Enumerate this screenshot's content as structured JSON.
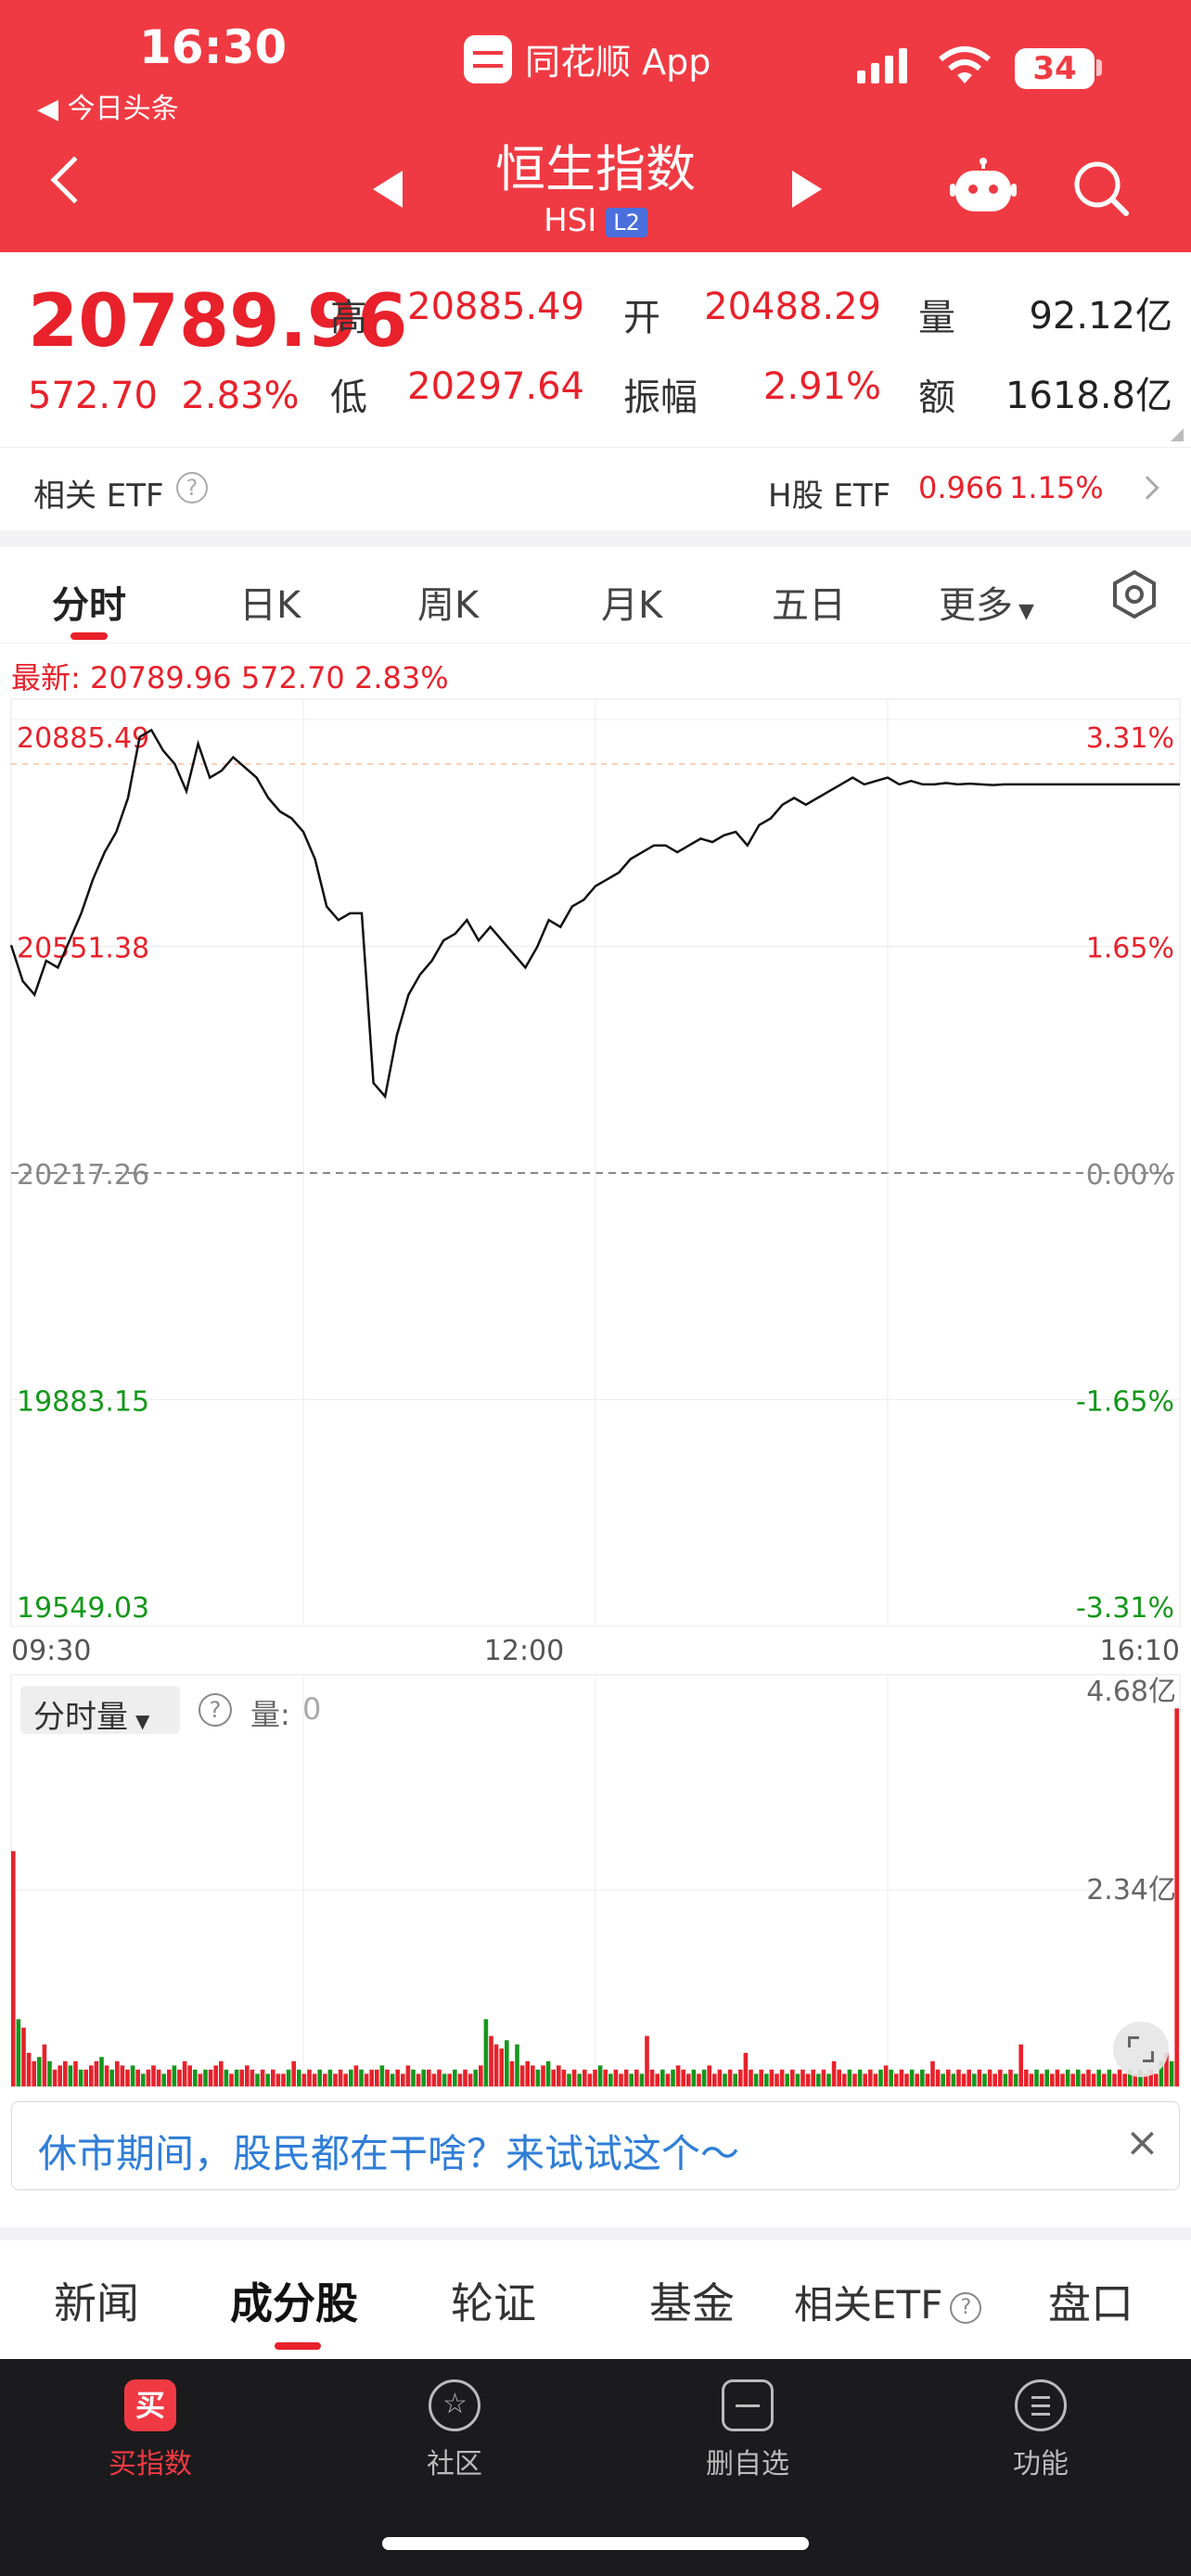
{
  "status_bar": {
    "time": "16:30",
    "back_app": "◀ 今日头条",
    "app_name": "同花顺 App",
    "battery": "34"
  },
  "header": {
    "title": "恒生指数",
    "code": "HSI",
    "level": "L2"
  },
  "quote": {
    "price": "20789.96",
    "change": "572.70",
    "change_pct": "2.83%",
    "high_label": "高",
    "high": "20885.49",
    "low_label": "低",
    "low": "20297.64",
    "open_label": "开",
    "open": "20488.29",
    "amp_label": "振幅",
    "amp": "2.91%",
    "vol_label": "量",
    "vol": "92.12亿",
    "amt_label": "额",
    "amt": "1618.8亿"
  },
  "etf": {
    "related_label": "相关 ETF",
    "h_label": "H股 ETF",
    "h_price": "0.966",
    "h_pct": "1.15%"
  },
  "tabs": [
    {
      "label": "分时"
    },
    {
      "label": "日K"
    },
    {
      "label": "周K"
    },
    {
      "label": "月K"
    },
    {
      "label": "五日"
    },
    {
      "label": "更多"
    }
  ],
  "latest_line": "最新: 20789.96  572.70  2.83%",
  "volume_panel": {
    "selector": "分时量",
    "qty_label": "量:",
    "qty_value": "0"
  },
  "colors": {
    "up": "#e8212b",
    "down": "#15971b",
    "brand": "#f03a43"
  },
  "chart_data": [
    {
      "type": "line",
      "ylabels_left": [
        "20885.49",
        "20551.38",
        "20217.26",
        "19883.15",
        "19549.03"
      ],
      "ylabels_right": [
        "3.31%",
        "1.65%",
        "0.00%",
        "-1.65%",
        "-3.31%"
      ],
      "x_ticks": [
        "09:30",
        "12:00",
        "16:10"
      ],
      "ylim": [
        19549.03,
        20885.49
      ],
      "prev_close": 20217.26,
      "x": [
        0,
        0.01,
        0.02,
        0.03,
        0.04,
        0.05,
        0.06,
        0.07,
        0.08,
        0.09,
        0.1,
        0.11,
        0.12,
        0.13,
        0.14,
        0.15,
        0.16,
        0.17,
        0.18,
        0.19,
        0.2,
        0.21,
        0.22,
        0.23,
        0.24,
        0.25,
        0.26,
        0.27,
        0.28,
        0.29,
        0.3,
        0.31,
        0.32,
        0.33,
        0.34,
        0.35,
        0.36,
        0.37,
        0.38,
        0.39,
        0.4,
        0.41,
        0.42,
        0.43,
        0.44,
        0.45,
        0.46,
        0.47,
        0.48,
        0.49,
        0.5,
        0.51,
        0.52,
        0.53,
        0.54,
        0.55,
        0.56,
        0.57,
        0.58,
        0.59,
        0.6,
        0.61,
        0.62,
        0.63,
        0.64,
        0.65,
        0.66,
        0.67,
        0.68,
        0.69,
        0.7,
        0.71,
        0.72,
        0.73,
        0.74,
        0.75,
        0.76,
        0.77,
        0.78,
        0.79,
        0.8,
        0.81,
        0.82,
        0.83,
        0.84,
        0.85,
        0.86,
        0.87,
        0.88,
        0.89,
        0.9,
        0.91,
        0.92,
        0.93,
        0.94,
        0.95,
        0.96,
        0.97,
        0.98,
        0.99,
        1.0
      ],
      "values": [
        20553,
        20500,
        20480,
        20530,
        20520,
        20560,
        20600,
        20650,
        20690,
        20720,
        20770,
        20860,
        20870,
        20840,
        20820,
        20780,
        20850,
        20800,
        20810,
        20830,
        20815,
        20800,
        20770,
        20750,
        20740,
        20720,
        20680,
        20610,
        20590,
        20600,
        20600,
        20350,
        20330,
        20420,
        20480,
        20510,
        20530,
        20560,
        20570,
        20590,
        20560,
        20580,
        20560,
        20540,
        20520,
        20550,
        20590,
        20580,
        20610,
        20620,
        20640,
        20650,
        20660,
        20680,
        20690,
        20700,
        20700,
        20690,
        20700,
        20710,
        20705,
        20715,
        20720,
        20700,
        20730,
        20740,
        20760,
        20770,
        20760,
        20770,
        20780,
        20790,
        20800,
        20790,
        20795,
        20800,
        20790,
        20795,
        20789.96,
        20790,
        20792,
        20790,
        20791,
        20790,
        20789,
        20790,
        20790,
        20789.96,
        20789.96,
        20789.96,
        20789.96,
        20789.96,
        20789.96,
        20789.96,
        20789.96,
        20789.96,
        20789.96,
        20789.96,
        20789.96,
        20789.96,
        20789.96
      ]
    },
    {
      "type": "bar",
      "ylabels": [
        "4.68亿",
        "2.34亿"
      ],
      "ylim": [
        0,
        4.68
      ],
      "values": [
        2.8,
        0.8,
        0.7,
        0.4,
        0.3,
        0.35,
        0.5,
        0.3,
        0.2,
        0.25,
        0.3,
        0.25,
        0.3,
        0.2,
        0.2,
        0.25,
        0.3,
        0.35,
        0.25,
        0.2,
        0.3,
        0.25,
        0.2,
        0.25,
        0.2,
        0.15,
        0.2,
        0.25,
        0.2,
        0.15,
        0.2,
        0.25,
        0.2,
        0.3,
        0.25,
        0.2,
        0.15,
        0.2,
        0.2,
        0.25,
        0.3,
        0.2,
        0.15,
        0.2,
        0.2,
        0.25,
        0.2,
        0.15,
        0.2,
        0.15,
        0.2,
        0.15,
        0.15,
        0.2,
        0.3,
        0.2,
        0.15,
        0.2,
        0.15,
        0.2,
        0.15,
        0.2,
        0.15,
        0.2,
        0.15,
        0.2,
        0.25,
        0.2,
        0.15,
        0.2,
        0.2,
        0.25,
        0.2,
        0.15,
        0.2,
        0.15,
        0.25,
        0.2,
        0.15,
        0.2,
        0.2,
        0.15,
        0.2,
        0.15,
        0.15,
        0.2,
        0.15,
        0.2,
        0.15,
        0.2,
        0.25,
        0.8,
        0.6,
        0.5,
        0.45,
        0.55,
        0.3,
        0.5,
        0.25,
        0.3,
        0.25,
        0.2,
        0.25,
        0.3,
        0.2,
        0.25,
        0.2,
        0.15,
        0.2,
        0.15,
        0.2,
        0.15,
        0.2,
        0.25,
        0.2,
        0.15,
        0.2,
        0.15,
        0.2,
        0.15,
        0.2,
        0.15,
        0.6,
        0.2,
        0.15,
        0.2,
        0.15,
        0.2,
        0.25,
        0.2,
        0.15,
        0.2,
        0.15,
        0.2,
        0.25,
        0.15,
        0.2,
        0.15,
        0.2,
        0.15,
        0.2,
        0.4,
        0.2,
        0.15,
        0.2,
        0.15,
        0.2,
        0.15,
        0.2,
        0.15,
        0.2,
        0.15,
        0.2,
        0.15,
        0.2,
        0.15,
        0.2,
        0.15,
        0.3,
        0.2,
        0.15,
        0.2,
        0.15,
        0.2,
        0.15,
        0.2,
        0.15,
        0.2,
        0.25,
        0.2,
        0.15,
        0.2,
        0.15,
        0.2,
        0.15,
        0.2,
        0.15,
        0.3,
        0.2,
        0.15,
        0.2,
        0.15,
        0.2,
        0.15,
        0.2,
        0.15,
        0.2,
        0.15,
        0.2,
        0.15,
        0.2,
        0.15,
        0.2,
        0.15,
        0.5,
        0.2,
        0.15,
        0.2,
        0.15,
        0.2,
        0.15,
        0.2,
        0.15,
        0.2,
        0.15,
        0.2,
        0.15,
        0.2,
        0.15,
        0.2,
        0.15,
        0.2,
        0.15,
        0.2,
        0.15,
        0.2,
        0.15,
        0.2,
        0.15,
        0.2,
        0.15,
        0.3,
        0.4,
        0.3,
        4.5
      ]
    }
  ],
  "banner": {
    "text": "休市期间，股民都在干啥？来试试这个～",
    "close": "×"
  },
  "bottom_tabs": [
    {
      "label": "新闻"
    },
    {
      "label": "成分股"
    },
    {
      "label": "轮证"
    },
    {
      "label": "基金"
    },
    {
      "label": "相关ETF"
    },
    {
      "label": "盘口"
    }
  ],
  "nav": [
    {
      "label": "买指数",
      "icon_text": "买"
    },
    {
      "label": "社区"
    },
    {
      "label": "删自选"
    },
    {
      "label": "功能"
    }
  ]
}
